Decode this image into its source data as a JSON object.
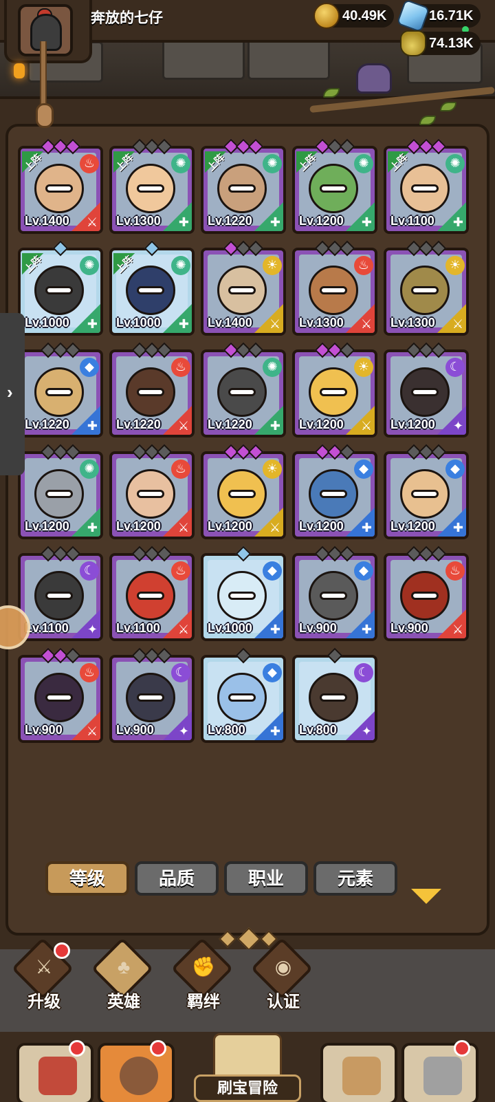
{
  "player": {
    "name": "奔放的七仔"
  },
  "resources": {
    "gold": "40.49K",
    "gems": "16.71K",
    "potion": "74.13K"
  },
  "deployed_label": "上阵",
  "heroes": [
    {
      "lv": "Lv.1400",
      "deployed": true,
      "el": "fire",
      "rarity": "purple",
      "diamonds": "ppp"
    },
    {
      "lv": "Lv.1300",
      "deployed": true,
      "el": "wind",
      "rarity": "purple",
      "diamonds": "ggg"
    },
    {
      "lv": "Lv.1220",
      "deployed": true,
      "el": "wind",
      "rarity": "purple",
      "diamonds": "ppp"
    },
    {
      "lv": "Lv.1200",
      "deployed": true,
      "el": "wind",
      "rarity": "purple",
      "diamonds": "pgg"
    },
    {
      "lv": "Lv.1100",
      "deployed": true,
      "el": "wind",
      "rarity": "purple",
      "diamonds": "ppp"
    },
    {
      "lv": "Lv.1000",
      "deployed": true,
      "el": "wind",
      "rarity": "blue",
      "diamonds": "b"
    },
    {
      "lv": "Lv.1000",
      "deployed": true,
      "el": "wind",
      "rarity": "blue",
      "diamonds": "b"
    },
    {
      "lv": "Lv.1400",
      "deployed": false,
      "el": "light",
      "rarity": "purple",
      "diamonds": "pgg"
    },
    {
      "lv": "Lv.1300",
      "deployed": false,
      "el": "fire",
      "rarity": "purple",
      "diamonds": "ggg"
    },
    {
      "lv": "Lv.1300",
      "deployed": false,
      "el": "light",
      "rarity": "purple",
      "diamonds": "ggg"
    },
    {
      "lv": "Lv.1220",
      "deployed": false,
      "el": "water",
      "rarity": "purple",
      "diamonds": "ggg"
    },
    {
      "lv": "Lv.1220",
      "deployed": false,
      "el": "fire",
      "rarity": "purple",
      "diamonds": "ggg"
    },
    {
      "lv": "Lv.1220",
      "deployed": false,
      "el": "wind",
      "rarity": "purple",
      "diamonds": "pgg"
    },
    {
      "lv": "Lv.1200",
      "deployed": false,
      "el": "light",
      "rarity": "purple",
      "diamonds": "ppg"
    },
    {
      "lv": "Lv.1200",
      "deployed": false,
      "el": "dark",
      "rarity": "purple",
      "diamonds": "ggg"
    },
    {
      "lv": "Lv.1200",
      "deployed": false,
      "el": "wind",
      "rarity": "purple",
      "diamonds": "ggg"
    },
    {
      "lv": "Lv.1200",
      "deployed": false,
      "el": "fire",
      "rarity": "purple",
      "diamonds": "ggg"
    },
    {
      "lv": "Lv.1200",
      "deployed": false,
      "el": "light",
      "rarity": "purple",
      "diamonds": "ppp"
    },
    {
      "lv": "Lv.1200",
      "deployed": false,
      "el": "water",
      "rarity": "purple",
      "diamonds": "ppg"
    },
    {
      "lv": "Lv.1200",
      "deployed": false,
      "el": "water",
      "rarity": "purple",
      "diamonds": "ggg"
    },
    {
      "lv": "Lv.1100",
      "deployed": false,
      "el": "dark",
      "rarity": "purple",
      "diamonds": "ggg"
    },
    {
      "lv": "Lv.1100",
      "deployed": false,
      "el": "fire",
      "rarity": "purple",
      "diamonds": "ggg"
    },
    {
      "lv": "Lv.1000",
      "deployed": false,
      "el": "water",
      "rarity": "blue",
      "diamonds": "b"
    },
    {
      "lv": "Lv.900",
      "deployed": false,
      "el": "water",
      "rarity": "purple",
      "diamonds": "ggg"
    },
    {
      "lv": "Lv.900",
      "deployed": false,
      "el": "fire",
      "rarity": "purple",
      "diamonds": "ggg"
    },
    {
      "lv": "Lv.900",
      "deployed": false,
      "el": "fire",
      "rarity": "purple",
      "diamonds": "ppg"
    },
    {
      "lv": "Lv.900",
      "deployed": false,
      "el": "dark",
      "rarity": "purple",
      "diamonds": "ggg"
    },
    {
      "lv": "Lv.800",
      "deployed": false,
      "el": "water",
      "rarity": "blue",
      "diamonds": "g"
    },
    {
      "lv": "Lv.800",
      "deployed": false,
      "el": "dark",
      "rarity": "blue",
      "diamonds": "g"
    }
  ],
  "sort_tabs": [
    "等级",
    "品质",
    "职业",
    "元素"
  ],
  "sub_nav": [
    "升级",
    "英雄",
    "羁绊",
    "认证"
  ],
  "bottom_nav": {
    "adventure_label": "刷宝冒险"
  },
  "colors": {
    "panel": "#3b2c1f",
    "purple_card": "#8b52b5",
    "blue_card": "#b3d8ea",
    "active_tab": "#c79a5a"
  }
}
